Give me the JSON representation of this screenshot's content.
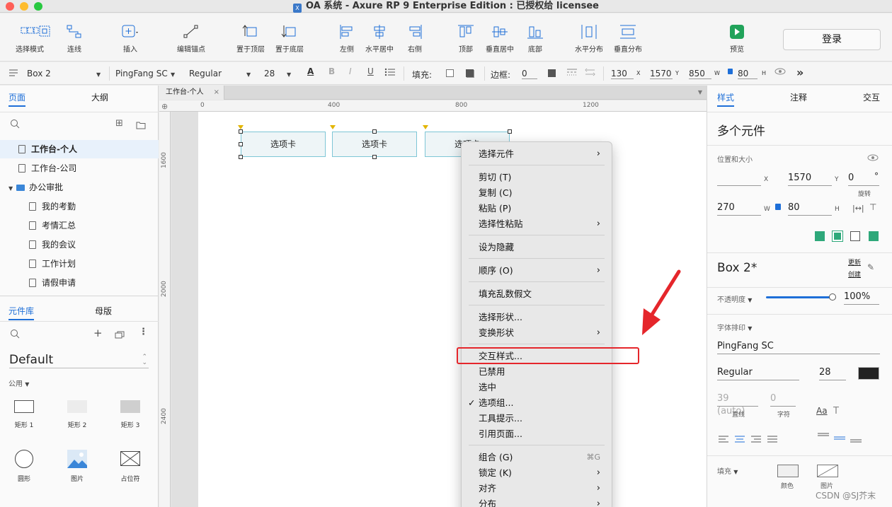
{
  "window": {
    "title": "OA 系统 - Axure RP 9 Enterprise Edition : 已授权给 licensee"
  },
  "toolbar": {
    "items": [
      {
        "label": "选择模式"
      },
      {
        "label": "连线"
      },
      {
        "label": "插入"
      },
      {
        "label": "编辑锚点"
      },
      {
        "label": "置于顶层"
      },
      {
        "label": "置于底层"
      },
      {
        "label": "左侧"
      },
      {
        "label": "水平居中"
      },
      {
        "label": "右侧"
      },
      {
        "label": "顶部"
      },
      {
        "label": "垂直居中"
      },
      {
        "label": "底部"
      },
      {
        "label": "水平分布"
      },
      {
        "label": "垂直分布"
      },
      {
        "label": "预览"
      }
    ],
    "login_label": "登录"
  },
  "format_bar": {
    "widget_name": "Box 2",
    "font_family": "PingFang SC",
    "font_weight": "Regular",
    "font_size": "28",
    "fill_label": "填充:",
    "border_label": "边框:",
    "border_value": "0",
    "x": "130",
    "x_unit": "X",
    "y": "1570",
    "y_unit": "Y",
    "w": "850",
    "w_unit": "W",
    "h": "80",
    "h_unit": "H"
  },
  "left_panel": {
    "tabs": {
      "pages": "页面",
      "outline": "大纲"
    },
    "pages": [
      {
        "label": "工作台-个人"
      },
      {
        "label": "工作台-公司"
      },
      {
        "label": "办公审批"
      },
      {
        "label": "我的考勤"
      },
      {
        "label": "考情汇总"
      },
      {
        "label": "我的会议"
      },
      {
        "label": "工作计划"
      },
      {
        "label": "请假申请"
      }
    ],
    "lib_tabs": {
      "library": "元件库",
      "masters": "母版"
    },
    "library_name": "Default",
    "category": "公用",
    "widgets": [
      {
        "label": "矩形 1"
      },
      {
        "label": "矩形 2"
      },
      {
        "label": "矩形 3"
      },
      {
        "label": "圆形"
      },
      {
        "label": "图片"
      },
      {
        "label": "占位符"
      }
    ]
  },
  "canvas": {
    "doc_tab": "工作台-个人",
    "ruler_h": [
      "0",
      "400",
      "800",
      "1200"
    ],
    "ruler_v": [
      "1600",
      "2000",
      "2400"
    ],
    "boxes": [
      {
        "label": "选项卡"
      },
      {
        "label": "选项卡"
      },
      {
        "label": "选项卡"
      }
    ]
  },
  "context_menu": {
    "items": [
      {
        "label": "选择元件",
        "submenu": true
      },
      {
        "label": "剪切 (T)"
      },
      {
        "label": "复制 (C)"
      },
      {
        "label": "粘贴 (P)"
      },
      {
        "label": "选择性粘贴",
        "submenu": true
      },
      {
        "label": "设为隐藏"
      },
      {
        "label": "顺序 (O)",
        "submenu": true
      },
      {
        "label": "填充乱数假文"
      },
      {
        "label": "选择形状..."
      },
      {
        "label": "变换形状",
        "submenu": true
      },
      {
        "label": "交互样式..."
      },
      {
        "label": "已禁用"
      },
      {
        "label": "选中"
      },
      {
        "label": "选项组...",
        "checked": true
      },
      {
        "label": "工具提示..."
      },
      {
        "label": "引用页面..."
      },
      {
        "label": "组合 (G)",
        "shortcut": "⌘G"
      },
      {
        "label": "锁定 (K)",
        "submenu": true
      },
      {
        "label": "对齐",
        "submenu": true
      },
      {
        "label": "分布",
        "submenu": true
      }
    ],
    "highlighted_item": "交互样式...",
    "highlight_color": "#e5262b"
  },
  "right_panel": {
    "tabs": {
      "style": "样式",
      "notes": "注释",
      "interact": "交互"
    },
    "heading": "多个元件",
    "pos_size_label": "位置和大小",
    "x_value": "",
    "y_value": "1570",
    "rotation_value": "0",
    "rotation_unit": "°",
    "rotation_label": "旋转",
    "w_value": "270",
    "h_value": "80",
    "x_unit": "X",
    "y_unit": "Y",
    "w_unit": "W",
    "h_unit": "H",
    "style_name": "Box 2*",
    "update_label": "更新",
    "create_label": "创建",
    "opacity_label": "不透明度",
    "opacity_value": "100%",
    "font_section_label": "字体排印",
    "font_family": "PingFang SC",
    "font_weight": "Regular",
    "font_size": "28",
    "line_height_value": "39 (auto)",
    "line_height_label": "直线",
    "char_spacing_value": "0",
    "char_spacing_label": "字符",
    "fill_label": "填充",
    "fill_color_label": "颜色",
    "fill_image_label": "图片"
  },
  "watermark": "CSDN @SJ芥末"
}
